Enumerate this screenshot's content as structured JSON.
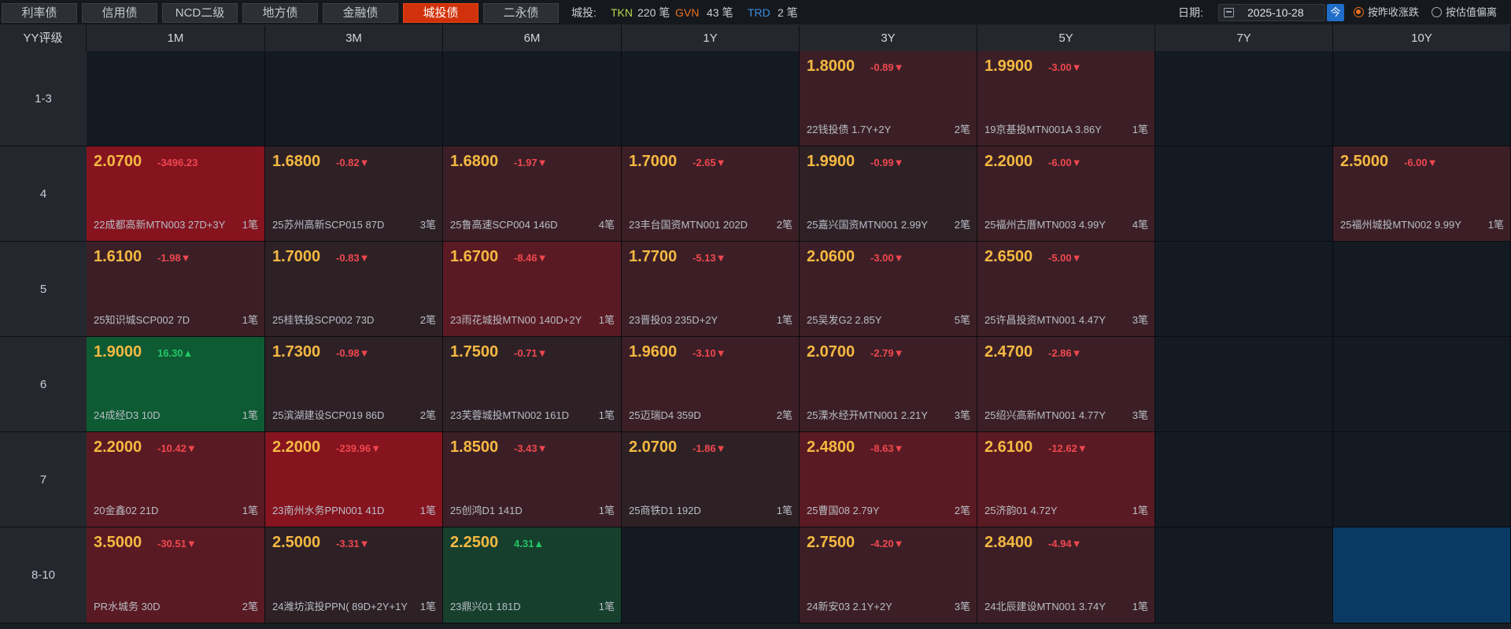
{
  "tabs": [
    "利率债",
    "信用债",
    "NCD二级",
    "地方债",
    "金融债",
    "城投债",
    "二永债"
  ],
  "active_tab": 5,
  "stats": {
    "label": "城投:",
    "tkn": {
      "name": "TKN",
      "value": "220 笔",
      "color": "#b7d64a"
    },
    "gvn": {
      "name": "GVN",
      "value": "43 笔",
      "color": "#e8701f"
    },
    "trd": {
      "name": "TRD",
      "value": "2 笔",
      "color": "#3d8ee0"
    }
  },
  "date": {
    "label": "日期:",
    "value": "2025-10-28",
    "today_button": "今"
  },
  "options": {
    "opt1": {
      "label": "按昨收涨跌",
      "selected": true
    },
    "opt2": {
      "label": "按估值偏离",
      "selected": false
    }
  },
  "header": {
    "corner": "YY评级"
  },
  "columns": [
    "1M",
    "3M",
    "6M",
    "1Y",
    "3Y",
    "5Y",
    "7Y",
    "10Y"
  ],
  "rows": [
    "1-3",
    "4",
    "5",
    "6",
    "7",
    "8-10"
  ],
  "colors": {
    "empty": "#141a22",
    "empty_blue": "#0a3a63",
    "red_strong": "#85141f",
    "red_med": "#5a1a23",
    "red_light": "#3c1f26",
    "red_faint": "#2e2126",
    "green_strong": "#0e5a33",
    "green_med": "#173f2e"
  },
  "cells": [
    [
      null,
      null,
      null,
      null,
      {
        "yield": "1.8000",
        "change": "-0.89▼",
        "dir": "down",
        "name": "22钱投债 1.7Y+2Y",
        "count": "2笔",
        "bg": "red_light"
      },
      {
        "yield": "1.9900",
        "change": "-3.00▼",
        "dir": "down",
        "name": "19京基投MTN001A 3.86Y",
        "count": "1笔",
        "bg": "red_light"
      },
      null,
      null
    ],
    [
      {
        "yield": "2.0700",
        "change": "-3496.23",
        "dir": "down",
        "name": "22成都高新MTN003 27D+3Y",
        "count": "1笔",
        "bg": "red_strong"
      },
      {
        "yield": "1.6800",
        "change": "-0.82▼",
        "dir": "down",
        "name": "25苏州高新SCP015 87D",
        "count": "3笔",
        "bg": "red_faint"
      },
      {
        "yield": "1.6800",
        "change": "-1.97▼",
        "dir": "down",
        "name": "25鲁高速SCP004 146D",
        "count": "4笔",
        "bg": "red_light"
      },
      {
        "yield": "1.7000",
        "change": "-2.65▼",
        "dir": "down",
        "name": "23丰台国资MTN001 202D",
        "count": "2笔",
        "bg": "red_light"
      },
      {
        "yield": "1.9900",
        "change": "-0.99▼",
        "dir": "down",
        "name": "25嘉兴国资MTN001 2.99Y",
        "count": "2笔",
        "bg": "red_faint"
      },
      {
        "yield": "2.2000",
        "change": "-6.00▼",
        "dir": "down",
        "name": "25福州古厝MTN003 4.99Y",
        "count": "4笔",
        "bg": "red_light"
      },
      null,
      {
        "yield": "2.5000",
        "change": "-6.00▼",
        "dir": "down",
        "name": "25福州城投MTN002 9.99Y",
        "count": "1笔",
        "bg": "red_light"
      }
    ],
    [
      {
        "yield": "1.6100",
        "change": "-1.98▼",
        "dir": "down",
        "name": "25知识城SCP002 7D",
        "count": "1笔",
        "bg": "red_light"
      },
      {
        "yield": "1.7000",
        "change": "-0.83▼",
        "dir": "down",
        "name": "25桂铁投SCP002 73D",
        "count": "2笔",
        "bg": "red_faint"
      },
      {
        "yield": "1.6700",
        "change": "-8.46▼",
        "dir": "down",
        "name": "23雨花城投MTN00 140D+2Y",
        "count": "1笔",
        "bg": "red_med"
      },
      {
        "yield": "1.7700",
        "change": "-5.13▼",
        "dir": "down",
        "name": "23晋投03 235D+2Y",
        "count": "1笔",
        "bg": "red_light"
      },
      {
        "yield": "2.0600",
        "change": "-3.00▼",
        "dir": "down",
        "name": "25吴发G2 2.85Y",
        "count": "5笔",
        "bg": "red_light"
      },
      {
        "yield": "2.6500",
        "change": "-5.00▼",
        "dir": "down",
        "name": "25许昌投资MTN001 4.47Y",
        "count": "3笔",
        "bg": "red_light"
      },
      null,
      null
    ],
    [
      {
        "yield": "1.9000",
        "change": "16.30▲",
        "dir": "up",
        "name": "24成经D3 10D",
        "count": "1笔",
        "bg": "green_strong"
      },
      {
        "yield": "1.7300",
        "change": "-0.98▼",
        "dir": "down",
        "name": "25滨湖建设SCP019 86D",
        "count": "2笔",
        "bg": "red_faint"
      },
      {
        "yield": "1.7500",
        "change": "-0.71▼",
        "dir": "down",
        "name": "23芙蓉城投MTN002 161D",
        "count": "1笔",
        "bg": "red_faint"
      },
      {
        "yield": "1.9600",
        "change": "-3.10▼",
        "dir": "down",
        "name": "25迈瑞D4 359D",
        "count": "2笔",
        "bg": "red_light"
      },
      {
        "yield": "2.0700",
        "change": "-2.79▼",
        "dir": "down",
        "name": "25溧水经开MTN001 2.21Y",
        "count": "3笔",
        "bg": "red_light"
      },
      {
        "yield": "2.4700",
        "change": "-2.86▼",
        "dir": "down",
        "name": "25绍兴高新MTN001 4.77Y",
        "count": "3笔",
        "bg": "red_light"
      },
      null,
      null
    ],
    [
      {
        "yield": "2.2000",
        "change": "-10.42▼",
        "dir": "down",
        "name": "20金鑫02 21D",
        "count": "1笔",
        "bg": "red_med"
      },
      {
        "yield": "2.2000",
        "change": "-239.96▼",
        "dir": "down",
        "name": "23南州水务PPN001 41D",
        "count": "1笔",
        "bg": "red_strong"
      },
      {
        "yield": "1.8500",
        "change": "-3.43▼",
        "dir": "down",
        "name": "25创鸿D1 141D",
        "count": "1笔",
        "bg": "red_light"
      },
      {
        "yield": "2.0700",
        "change": "-1.86▼",
        "dir": "down",
        "name": "25商铁D1 192D",
        "count": "1笔",
        "bg": "red_faint"
      },
      {
        "yield": "2.4800",
        "change": "-8.63▼",
        "dir": "down",
        "name": "25曹国08 2.79Y",
        "count": "2笔",
        "bg": "red_med"
      },
      {
        "yield": "2.6100",
        "change": "-12.62▼",
        "dir": "down",
        "name": "25济韵01 4.72Y",
        "count": "1笔",
        "bg": "red_med"
      },
      null,
      null
    ],
    [
      {
        "yield": "3.5000",
        "change": "-30.51▼",
        "dir": "down",
        "name": "PR水城务 30D",
        "count": "2笔",
        "bg": "red_med"
      },
      {
        "yield": "2.5000",
        "change": "-3.31▼",
        "dir": "down",
        "name": "24潍坊滨投PPN( 89D+2Y+1Y",
        "count": "1笔",
        "bg": "red_faint"
      },
      {
        "yield": "2.2500",
        "change": "4.31▲",
        "dir": "up",
        "name": "23鼎兴01 181D",
        "count": "1笔",
        "bg": "green_med"
      },
      null,
      {
        "yield": "2.7500",
        "change": "-4.20▼",
        "dir": "down",
        "name": "24新安03 2.1Y+2Y",
        "count": "3笔",
        "bg": "red_light"
      },
      {
        "yield": "2.8400",
        "change": "-4.94▼",
        "dir": "down",
        "name": "24北辰建设MTN001 3.74Y",
        "count": "1笔",
        "bg": "red_light"
      },
      null,
      "empty_blue"
    ]
  ]
}
